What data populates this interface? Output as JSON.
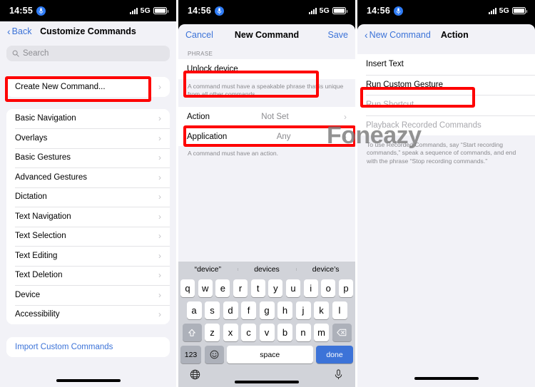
{
  "watermark": "Foneazy",
  "accent": {
    "blue": "#3c73d8",
    "red_highlight": "#fe0000",
    "gray_text": "#8a8a8e",
    "sheet_bg": "#f2f2f7",
    "keyboard_bg": "#d1d3d9"
  },
  "panel1": {
    "statusbar": {
      "time": "14:55",
      "mic_icon": "voice-control-mic-icon",
      "signal_icon": "cellular-bars-icon",
      "network": "5G",
      "battery_icon": "battery-icon"
    },
    "nav": {
      "back_label": "Back",
      "title": "Customize Commands"
    },
    "search": {
      "placeholder": "Search",
      "icon": "search-icon"
    },
    "create_row": {
      "label": "Create New Command...",
      "chevron": "chevron-right-icon"
    },
    "categories": [
      {
        "label": "Basic Navigation"
      },
      {
        "label": "Overlays"
      },
      {
        "label": "Basic Gestures"
      },
      {
        "label": "Advanced Gestures"
      },
      {
        "label": "Dictation"
      },
      {
        "label": "Text Navigation"
      },
      {
        "label": "Text Selection"
      },
      {
        "label": "Text Editing"
      },
      {
        "label": "Text Deletion"
      },
      {
        "label": "Device"
      },
      {
        "label": "Accessibility"
      }
    ],
    "import_row": {
      "label": "Import Custom Commands"
    }
  },
  "panel2": {
    "statusbar": {
      "time": "14:56",
      "mic_icon": "voice-control-mic-icon",
      "signal_icon": "cellular-bars-icon",
      "network": "5G",
      "battery_icon": "battery-icon"
    },
    "nav": {
      "cancel_label": "Cancel",
      "title": "New Command",
      "save_label": "Save"
    },
    "phrase_section_label": "PHRASE",
    "phrase_value": "Unlock device",
    "phrase_footnote": "A command must have a speakable phrase that is unique from all other commands.",
    "action_row": {
      "label": "Action",
      "value": "Not Set",
      "chevron": "chevron-right-icon"
    },
    "application_row": {
      "label": "Application",
      "value": "Any",
      "chevron": "chevron-right-icon"
    },
    "action_footnote": "A command must have an action.",
    "keyboard": {
      "predictions": [
        "“device”",
        "devices",
        "device’s"
      ],
      "row1": [
        "q",
        "w",
        "e",
        "r",
        "t",
        "y",
        "u",
        "i",
        "o",
        "p"
      ],
      "row2": [
        "a",
        "s",
        "d",
        "f",
        "g",
        "h",
        "j",
        "k",
        "l"
      ],
      "row3": [
        "z",
        "x",
        "c",
        "v",
        "b",
        "n",
        "m"
      ],
      "shift_icon": "shift-key-icon",
      "backspace_icon": "backspace-key-icon",
      "numbers_label": "123",
      "emoji_icon": "emoji-key-icon",
      "space_label": "space",
      "done_label": "done",
      "globe_icon": "globe-key-icon",
      "dictation_icon": "dictation-mic-icon"
    }
  },
  "panel3": {
    "statusbar": {
      "time": "14:56",
      "mic_icon": "voice-control-mic-icon",
      "signal_icon": "cellular-bars-icon",
      "network": "5G",
      "battery_icon": "battery-icon"
    },
    "nav": {
      "back_label": "New Command",
      "title": "Action"
    },
    "options": [
      {
        "label": "Insert Text",
        "disabled": false
      },
      {
        "label": "Run Custom Gesture",
        "disabled": false
      },
      {
        "label": "Run Shortcut",
        "disabled": true
      },
      {
        "label": "Playback Recorded Commands",
        "disabled": true
      }
    ],
    "footnote": "To use Recorded Commands, say “Start recording commands,” speak a sequence of commands, and end with the phrase “Stop recording commands.”"
  }
}
